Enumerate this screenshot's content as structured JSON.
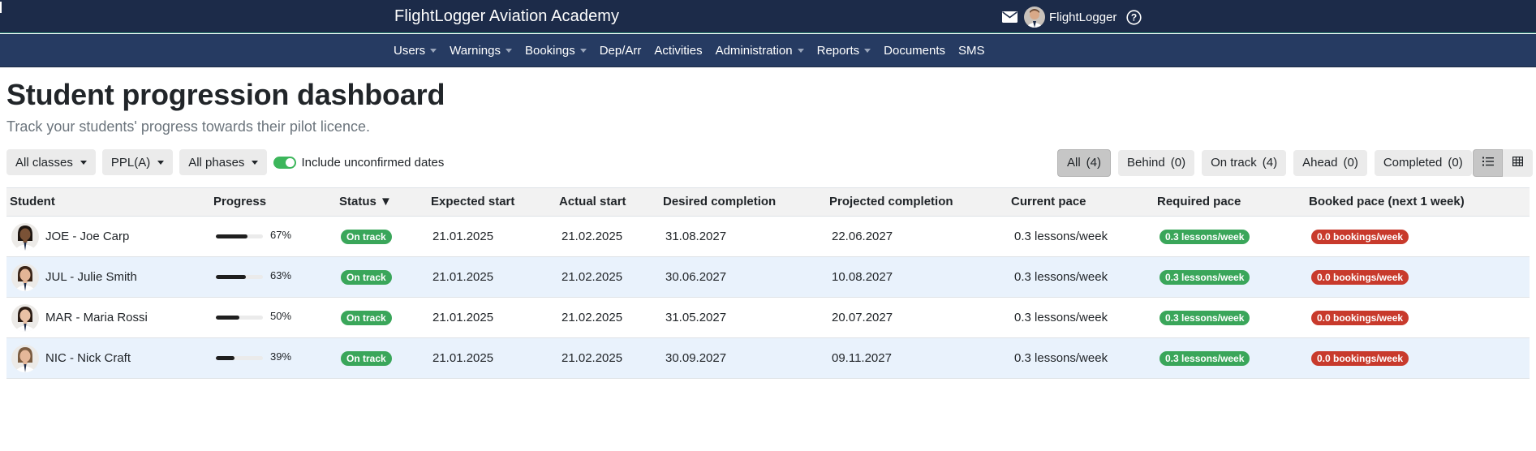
{
  "app": {
    "brand": "FlightLogger Aviation Academy",
    "user_name": "FlightLogger",
    "icons": {
      "mail": "mail-icon",
      "help": "help-icon"
    }
  },
  "nav": {
    "items": [
      {
        "label": "Users",
        "dropdown": true
      },
      {
        "label": "Warnings",
        "dropdown": true
      },
      {
        "label": "Bookings",
        "dropdown": true
      },
      {
        "label": "Dep/Arr",
        "dropdown": false
      },
      {
        "label": "Activities",
        "dropdown": false
      },
      {
        "label": "Administration",
        "dropdown": true
      },
      {
        "label": "Reports",
        "dropdown": true
      },
      {
        "label": "Documents",
        "dropdown": false
      },
      {
        "label": "SMS",
        "dropdown": false
      }
    ]
  },
  "page": {
    "title": "Student progression dashboard",
    "subtitle": "Track your students' progress towards their pilot licence."
  },
  "filters": {
    "classes": "All classes",
    "licence": "PPL(A)",
    "phases": "All phases",
    "toggle_label": "Include unconfirmed dates",
    "toggle_on": true
  },
  "status_filters": [
    {
      "label": "All",
      "count": "(4)",
      "active": true
    },
    {
      "label": "Behind",
      "count": "(0)",
      "active": false
    },
    {
      "label": "On track",
      "count": "(4)",
      "active": false
    },
    {
      "label": "Ahead",
      "count": "(0)",
      "active": false
    },
    {
      "label": "Completed",
      "count": "(0)",
      "active": false
    }
  ],
  "view_modes": {
    "list": "list-view-icon",
    "grid": "grid-view-icon",
    "active": "list"
  },
  "table": {
    "headers": {
      "student": "Student",
      "progress": "Progress",
      "status": "Status ▼",
      "expected_start": "Expected start",
      "actual_start": "Actual start",
      "desired_completion": "Desired completion",
      "projected_completion": "Projected completion",
      "current_pace": "Current pace",
      "required_pace": "Required pace",
      "booked_pace": "Booked pace (next 1 week)"
    },
    "rows": [
      {
        "student": "JOE - Joe Carp",
        "progress": 0.67,
        "progress_label": "67%",
        "status": "On track",
        "expected_start": "21.01.2025",
        "actual_start": "21.02.2025",
        "desired_completion": "31.08.2027",
        "projected_completion": "22.06.2027",
        "current_pace": "0.3 lessons/week",
        "required_pace": "0.3 lessons/week",
        "booked_pace": "0.0 bookings/week",
        "avatar": {
          "skin": "#7a5236",
          "hair": "#1d1510",
          "shirt": "#ffffff"
        }
      },
      {
        "student": "JUL - Julie Smith",
        "progress": 0.63,
        "progress_label": "63%",
        "status": "On track",
        "expected_start": "21.01.2025",
        "actual_start": "21.02.2025",
        "desired_completion": "30.06.2027",
        "projected_completion": "10.08.2027",
        "current_pace": "0.3 lessons/week",
        "required_pace": "0.3 lessons/week",
        "booked_pace": "0.0 bookings/week",
        "avatar": {
          "skin": "#e3b596",
          "hair": "#3a2417",
          "shirt": "#ffffff"
        }
      },
      {
        "student": "MAR - Maria Rossi",
        "progress": 0.5,
        "progress_label": "50%",
        "status": "On track",
        "expected_start": "21.01.2025",
        "actual_start": "21.02.2025",
        "desired_completion": "31.05.2027",
        "projected_completion": "20.07.2027",
        "current_pace": "0.3 lessons/week",
        "required_pace": "0.3 lessons/week",
        "booked_pace": "0.0 bookings/week",
        "avatar": {
          "skin": "#e9c1a5",
          "hair": "#2b1c14",
          "shirt": "#ffffff"
        }
      },
      {
        "student": "NIC - Nick Craft",
        "progress": 0.39,
        "progress_label": "39%",
        "status": "On track",
        "expected_start": "21.01.2025",
        "actual_start": "21.02.2025",
        "desired_completion": "30.09.2027",
        "projected_completion": "09.11.2027",
        "current_pace": "0.3 lessons/week",
        "required_pace": "0.3 lessons/week",
        "booked_pace": "0.0 bookings/week",
        "avatar": {
          "skin": "#e4b799",
          "hair": "#7a5b40",
          "shirt": "#ffffff"
        }
      }
    ]
  },
  "colors": {
    "topbar": "#1c2b49",
    "navbar": "#263b62",
    "ok": "#3aa65a",
    "danger": "#c83a2c",
    "row_alt": "#e9f2fc"
  }
}
